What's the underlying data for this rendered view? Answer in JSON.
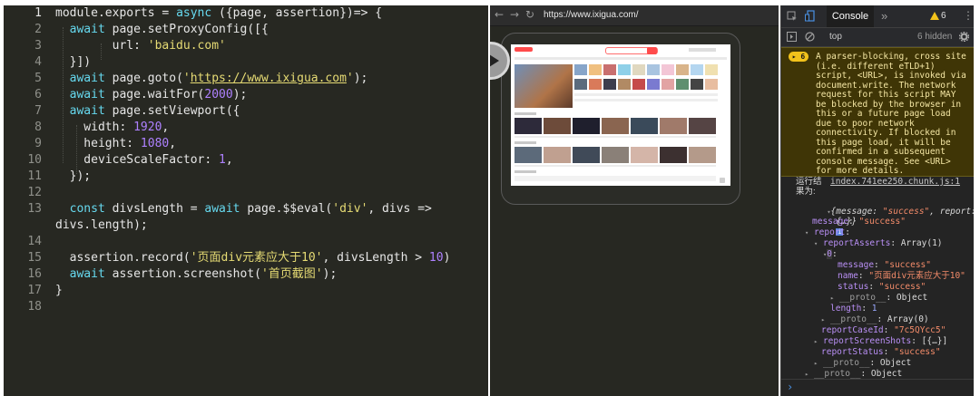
{
  "editor": {
    "active_line": 1,
    "lines": [
      {
        "n": "1",
        "tokens": [
          {
            "t": "module.exports = ",
            "c": "f"
          },
          {
            "t": "async",
            "c": "k"
          },
          {
            "t": " ({page, assertion})=> {",
            "c": "f"
          }
        ]
      },
      {
        "n": "2",
        "tokens": [
          {
            "t": "  await",
            "c": "k"
          },
          {
            "t": " page.setProxyConfig([{",
            "c": "f"
          }
        ]
      },
      {
        "n": "3",
        "tokens": [
          {
            "t": "        url: ",
            "c": "f"
          },
          {
            "t": "'baidu.com'",
            "c": "s"
          }
        ]
      },
      {
        "n": "4",
        "tokens": [
          {
            "t": "  }])",
            "c": "f"
          }
        ]
      },
      {
        "n": "5",
        "tokens": [
          {
            "t": "  await",
            "c": "k"
          },
          {
            "t": " page.goto(",
            "c": "f"
          },
          {
            "t": "'",
            "c": "s"
          },
          {
            "t": "https://www.ixigua.com",
            "c": "s u"
          },
          {
            "t": "'",
            "c": "s"
          },
          {
            "t": ");",
            "c": "f"
          }
        ]
      },
      {
        "n": "6",
        "tokens": [
          {
            "t": "  await",
            "c": "k"
          },
          {
            "t": " page.waitFor(",
            "c": "f"
          },
          {
            "t": "2000",
            "c": "n"
          },
          {
            "t": ");",
            "c": "f"
          }
        ]
      },
      {
        "n": "7",
        "tokens": [
          {
            "t": "  await",
            "c": "k"
          },
          {
            "t": " page.setViewport({",
            "c": "f"
          }
        ]
      },
      {
        "n": "8",
        "tokens": [
          {
            "t": "    width: ",
            "c": "f"
          },
          {
            "t": "1920",
            "c": "n"
          },
          {
            "t": ",",
            "c": "f"
          }
        ]
      },
      {
        "n": "9",
        "tokens": [
          {
            "t": "    height: ",
            "c": "f"
          },
          {
            "t": "1080",
            "c": "n"
          },
          {
            "t": ",",
            "c": "f"
          }
        ]
      },
      {
        "n": "10",
        "tokens": [
          {
            "t": "    deviceScaleFactor: ",
            "c": "f"
          },
          {
            "t": "1",
            "c": "n"
          },
          {
            "t": ",",
            "c": "f"
          }
        ]
      },
      {
        "n": "11",
        "tokens": [
          {
            "t": "  });",
            "c": "f"
          }
        ]
      },
      {
        "n": "12",
        "tokens": []
      },
      {
        "n": "13",
        "tokens": [
          {
            "t": "  const",
            "c": "k"
          },
          {
            "t": " divsLength = ",
            "c": "f"
          },
          {
            "t": "await",
            "c": "k"
          },
          {
            "t": " page.$$eval(",
            "c": "f"
          },
          {
            "t": "'div'",
            "c": "s"
          },
          {
            "t": ", divs =>",
            "c": "f"
          }
        ]
      },
      {
        "n": "",
        "tokens": [
          {
            "t": "divs.length);",
            "c": "f"
          }
        ]
      },
      {
        "n": "14",
        "tokens": []
      },
      {
        "n": "15",
        "tokens": [
          {
            "t": "  assertion.record(",
            "c": "f"
          },
          {
            "t": "'页面div元素应大于10'",
            "c": "s"
          },
          {
            "t": ", divsLength > ",
            "c": "f"
          },
          {
            "t": "10",
            "c": "n"
          },
          {
            "t": ")",
            "c": "f"
          }
        ]
      },
      {
        "n": "16",
        "tokens": [
          {
            "t": "  await",
            "c": "k"
          },
          {
            "t": " assertion.screenshot(",
            "c": "f"
          },
          {
            "t": "'首页截图'",
            "c": "s"
          },
          {
            "t": ");",
            "c": "f"
          }
        ]
      },
      {
        "n": "17",
        "tokens": [
          {
            "t": "}",
            "c": "f"
          }
        ]
      },
      {
        "n": "18",
        "tokens": []
      }
    ]
  },
  "browser": {
    "back_icon": "arrow-left-icon",
    "forward_icon": "arrow-right-icon",
    "reload_icon": "reload-icon",
    "url": "https://www.ixigua.com/",
    "play_icon": "play-icon"
  },
  "devtools": {
    "tab_label": "Console",
    "more_tabs": "»",
    "warning_count": "6",
    "context": "top",
    "hidden_count": "6 hidden",
    "warning_badge": "▸ 6",
    "warning_lines": [
      "A parser-blocking, cross site",
      "(i.e. different eTLD+1)",
      "script, <URL>, is invoked via",
      "document.write. The network",
      "request for this script MAY",
      "be blocked by the browser in",
      "this or a future page load",
      "due to poor network",
      "connectivity. If blocked in",
      "this page load, it will be",
      "confirmed in a subsequent",
      "console message. See <URL>",
      "for more details."
    ],
    "log_prefix": "运行结",
    "log_source": "index.741ee250.chunk.js:1",
    "log_result_label": "果为:",
    "object": {
      "summary_key1": "message",
      "summary_val1": "\"success\"",
      "summary_key2": "report",
      "summary_tail": "{…}}",
      "info_badge": "i",
      "message_key": "message",
      "message_val": "\"success\"",
      "report_key": "report",
      "reportAsserts_key": "reportAsserts",
      "reportAsserts_val": "Array(1)",
      "index0": "0",
      "item_message_key": "message",
      "item_message_val": "\"success\"",
      "item_name_key": "name",
      "item_name_val": "\"页面div元素应大于10\"",
      "item_status_key": "status",
      "item_status_val": "\"success\"",
      "proto_key": "__proto__",
      "proto_object": "Object",
      "length_key": "length",
      "length_val": "1",
      "proto_array": "Array(0)",
      "reportCaseId_key": "reportCaseId",
      "reportCaseId_val": "\"7c5QYcc5\"",
      "reportScreenShots_key": "reportScreenShots",
      "reportScreenShots_val": "[{…}]",
      "reportStatus_key": "reportStatus",
      "reportStatus_val": "\"success\""
    },
    "prompt": "›"
  }
}
